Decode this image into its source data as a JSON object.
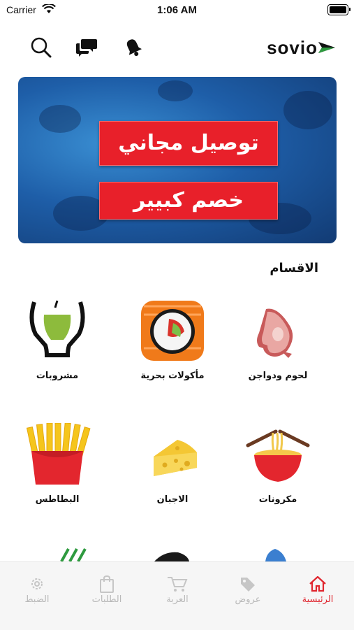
{
  "status": {
    "carrier": "Carrier",
    "time": "1:06 AM"
  },
  "header": {
    "logo": "sovio",
    "icons": [
      "search-icon",
      "chat-icon",
      "bell-icon"
    ]
  },
  "banner": {
    "line1": "توصيل مجاني",
    "line2": "خصم كبيير"
  },
  "categories": {
    "title": "الاقسام",
    "items": [
      {
        "label": "لحوم ودواجن"
      },
      {
        "label": "مأكولات بحرية"
      },
      {
        "label": "مشروبات"
      },
      {
        "label": "مكرونات"
      },
      {
        "label": "الاجبان"
      },
      {
        "label": "البطاطس"
      }
    ]
  },
  "tabs": [
    {
      "label": "الرئيسية",
      "icon": "home-icon",
      "active": true
    },
    {
      "label": "عروض",
      "icon": "tag-icon",
      "active": false
    },
    {
      "label": "العربة",
      "icon": "cart-icon",
      "active": false
    },
    {
      "label": "الطلبات",
      "icon": "bag-icon",
      "active": false
    },
    {
      "label": "الضبط",
      "icon": "gear-icon",
      "active": false
    }
  ],
  "colors": {
    "accent": "#e0262f",
    "inactive": "#b9b9b9",
    "banner_blue": "#1e5ea8"
  }
}
